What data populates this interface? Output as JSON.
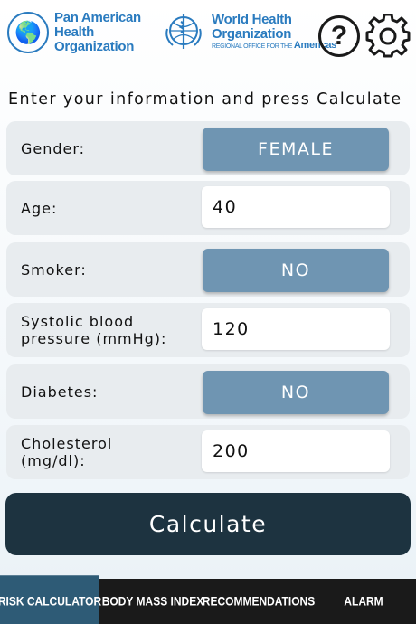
{
  "header": {
    "paho": {
      "line1": "Pan American",
      "line2": "Health",
      "line3": "Organization"
    },
    "who": {
      "line1": "World Health",
      "line2": "Organization",
      "sub_small": "REGIONAL OFFICE FOR THE",
      "sub_region": "Americas"
    },
    "help_label": "?"
  },
  "form": {
    "intro": "Enter your information and press Calculate",
    "gender": {
      "label": "Gender:",
      "value": "FEMALE"
    },
    "age": {
      "label": "Age:",
      "value": "40"
    },
    "smoker": {
      "label": "Smoker:",
      "value": "NO"
    },
    "systolic": {
      "label_line1": "Systolic blood",
      "label_line2": "pressure (mmHg):",
      "value": "120"
    },
    "diabetes": {
      "label": "Diabetes:",
      "value": "NO"
    },
    "cholesterol": {
      "label_line1": "Cholesterol",
      "label_line2": "(mg/dl):",
      "value": "200"
    }
  },
  "calculate_label": "Calculate",
  "tabs": [
    {
      "label": "RISK CALCULATOR",
      "active": true
    },
    {
      "label": "BODY MASS INDEX",
      "active": false
    },
    {
      "label": "RECOMMENDATIONS",
      "active": false
    },
    {
      "label": "ALARM",
      "active": false
    }
  ],
  "colors": {
    "toggle": "#6f95b2",
    "calculate": "#1d3340",
    "tab_active": "#2e5b76",
    "tabbar": "#1a1a1a",
    "logo": "#2a7bbf"
  },
  "icons": {
    "paho_emblem": "globe-icon",
    "who_emblem": "who-emblem-icon",
    "help": "help-icon",
    "settings": "gear-icon"
  }
}
